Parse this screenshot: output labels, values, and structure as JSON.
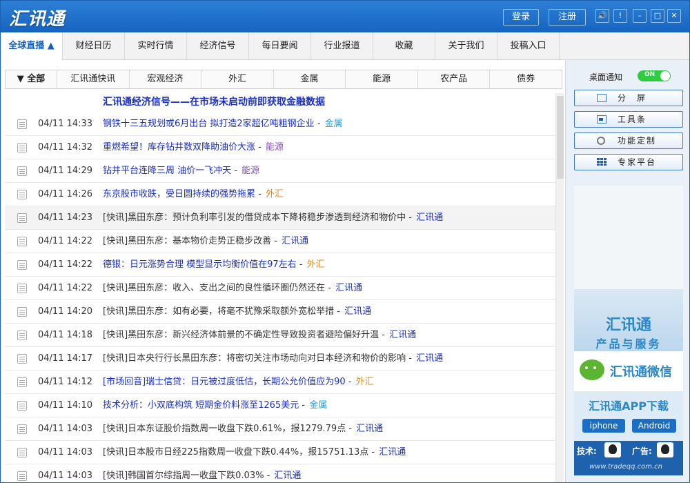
{
  "app": {
    "logo": "汇讯通"
  },
  "titlebar": {
    "login": "登录",
    "register": "注册",
    "sound": "🔊",
    "alert": "!",
    "minimize": "–",
    "maximize": "□",
    "close": "✕"
  },
  "nav": {
    "tabs": [
      "全球直播 ▲",
      "财经日历",
      "实时行情",
      "经济信号",
      "每日要闻",
      "行业报道",
      "收藏",
      "关于我们",
      "投稿入口"
    ]
  },
  "filters": [
    "▼ 全部",
    "汇讯通快讯",
    "宏观经济",
    "外汇",
    "金属",
    "能源",
    "农产品",
    "债券"
  ],
  "headline": "汇讯通经济信号——在市场未启动前即获取金融数据",
  "news": [
    {
      "time": "04/11 14:33",
      "title": "钢铁十三五规划或6月出台 拟打造2家超亿吨粗钢企业",
      "cat": "金属",
      "type": "std"
    },
    {
      "time": "04/11 14:32",
      "title": "重燃希望！库存钻井数双降助油价大涨",
      "cat": "能源",
      "type": "std"
    },
    {
      "time": "04/11 14:29",
      "title": "钻井平台连降三周 油价一飞冲天",
      "cat": "能源",
      "type": "std"
    },
    {
      "time": "04/11 14:26",
      "title": "东京股市收跌，受日圆持续的强势拖累",
      "cat": "外汇",
      "type": "std"
    },
    {
      "time": "04/11 14:23",
      "title": "[快讯]黑田东彦：预计负利率引发的借贷成本下降将稳步渗透到经济和物价中",
      "cat": "汇讯通",
      "type": "quick"
    },
    {
      "time": "04/11 14:22",
      "title": "[快讯]黑田东彦：基本物价走势正稳步改善",
      "cat": "汇讯通",
      "type": "quick"
    },
    {
      "time": "04/11 14:22",
      "title": "德银：日元涨势合理 模型显示均衡价值在97左右",
      "cat": "外汇",
      "type": "std"
    },
    {
      "time": "04/11 14:22",
      "title": "[快讯]黑田东彦：收入、支出之间的良性循环圈仍然还在",
      "cat": "汇讯通",
      "type": "quick"
    },
    {
      "time": "04/11 14:20",
      "title": "[快讯]黑田东彦：如有必要，将毫不犹豫采取额外宽松举措",
      "cat": "汇讯通",
      "type": "quick"
    },
    {
      "time": "04/11 14:18",
      "title": "[快讯]黑田东彦：新兴经济体前景的不确定性导致投资者避险偏好升温",
      "cat": "汇讯通",
      "type": "quick"
    },
    {
      "time": "04/11 14:17",
      "title": "[快讯]日本央行行长黑田东彦：将密切关注市场动向对日本经济和物价的影响",
      "cat": "汇讯通",
      "type": "quick"
    },
    {
      "time": "04/11 14:12",
      "title": "[市场回音]瑞士信贷：日元被过度低估，长期公允价值应为90",
      "cat": "外汇",
      "type": "std"
    },
    {
      "time": "04/11 14:10",
      "title": "技术分析：小双底构筑 短期金价料涨至1265美元",
      "cat": "金属",
      "type": "std"
    },
    {
      "time": "04/11 14:03",
      "title": "[快讯]日本东证股价指数周一收盘下跌0.61%，报1279.79点",
      "cat": "汇讯通",
      "type": "quick"
    },
    {
      "time": "04/11 14:03",
      "title": "[快讯]日本股市日经225指数周一收盘下跌0.44%，报15751.13点",
      "cat": "汇讯通",
      "type": "quick"
    },
    {
      "time": "04/11 14:03",
      "title": "[快讯]韩国首尔综指周一收盘下跌0.03%",
      "cat": "汇讯通",
      "type": "quick"
    }
  ],
  "cat_colors": {
    "金属": "#2a9fd6",
    "能源": "#8a4fc0",
    "外汇": "#e08a1e",
    "汇讯通": "#1a2fbf"
  },
  "side": {
    "notify_label": "桌面通知",
    "toggle": "ON",
    "buttons": [
      "分　屏",
      "工具条",
      "功能定制",
      "专家平台"
    ]
  },
  "ad": {
    "brand": "汇讯通",
    "services": "产品与服务",
    "wechat": "汇讯通微信",
    "app_title": "汇讯通APP下载",
    "iphone": "iphone",
    "android": "Android",
    "tech": "技术:",
    "adv": "广告:",
    "url": "www.tradeqq.com.cn"
  }
}
